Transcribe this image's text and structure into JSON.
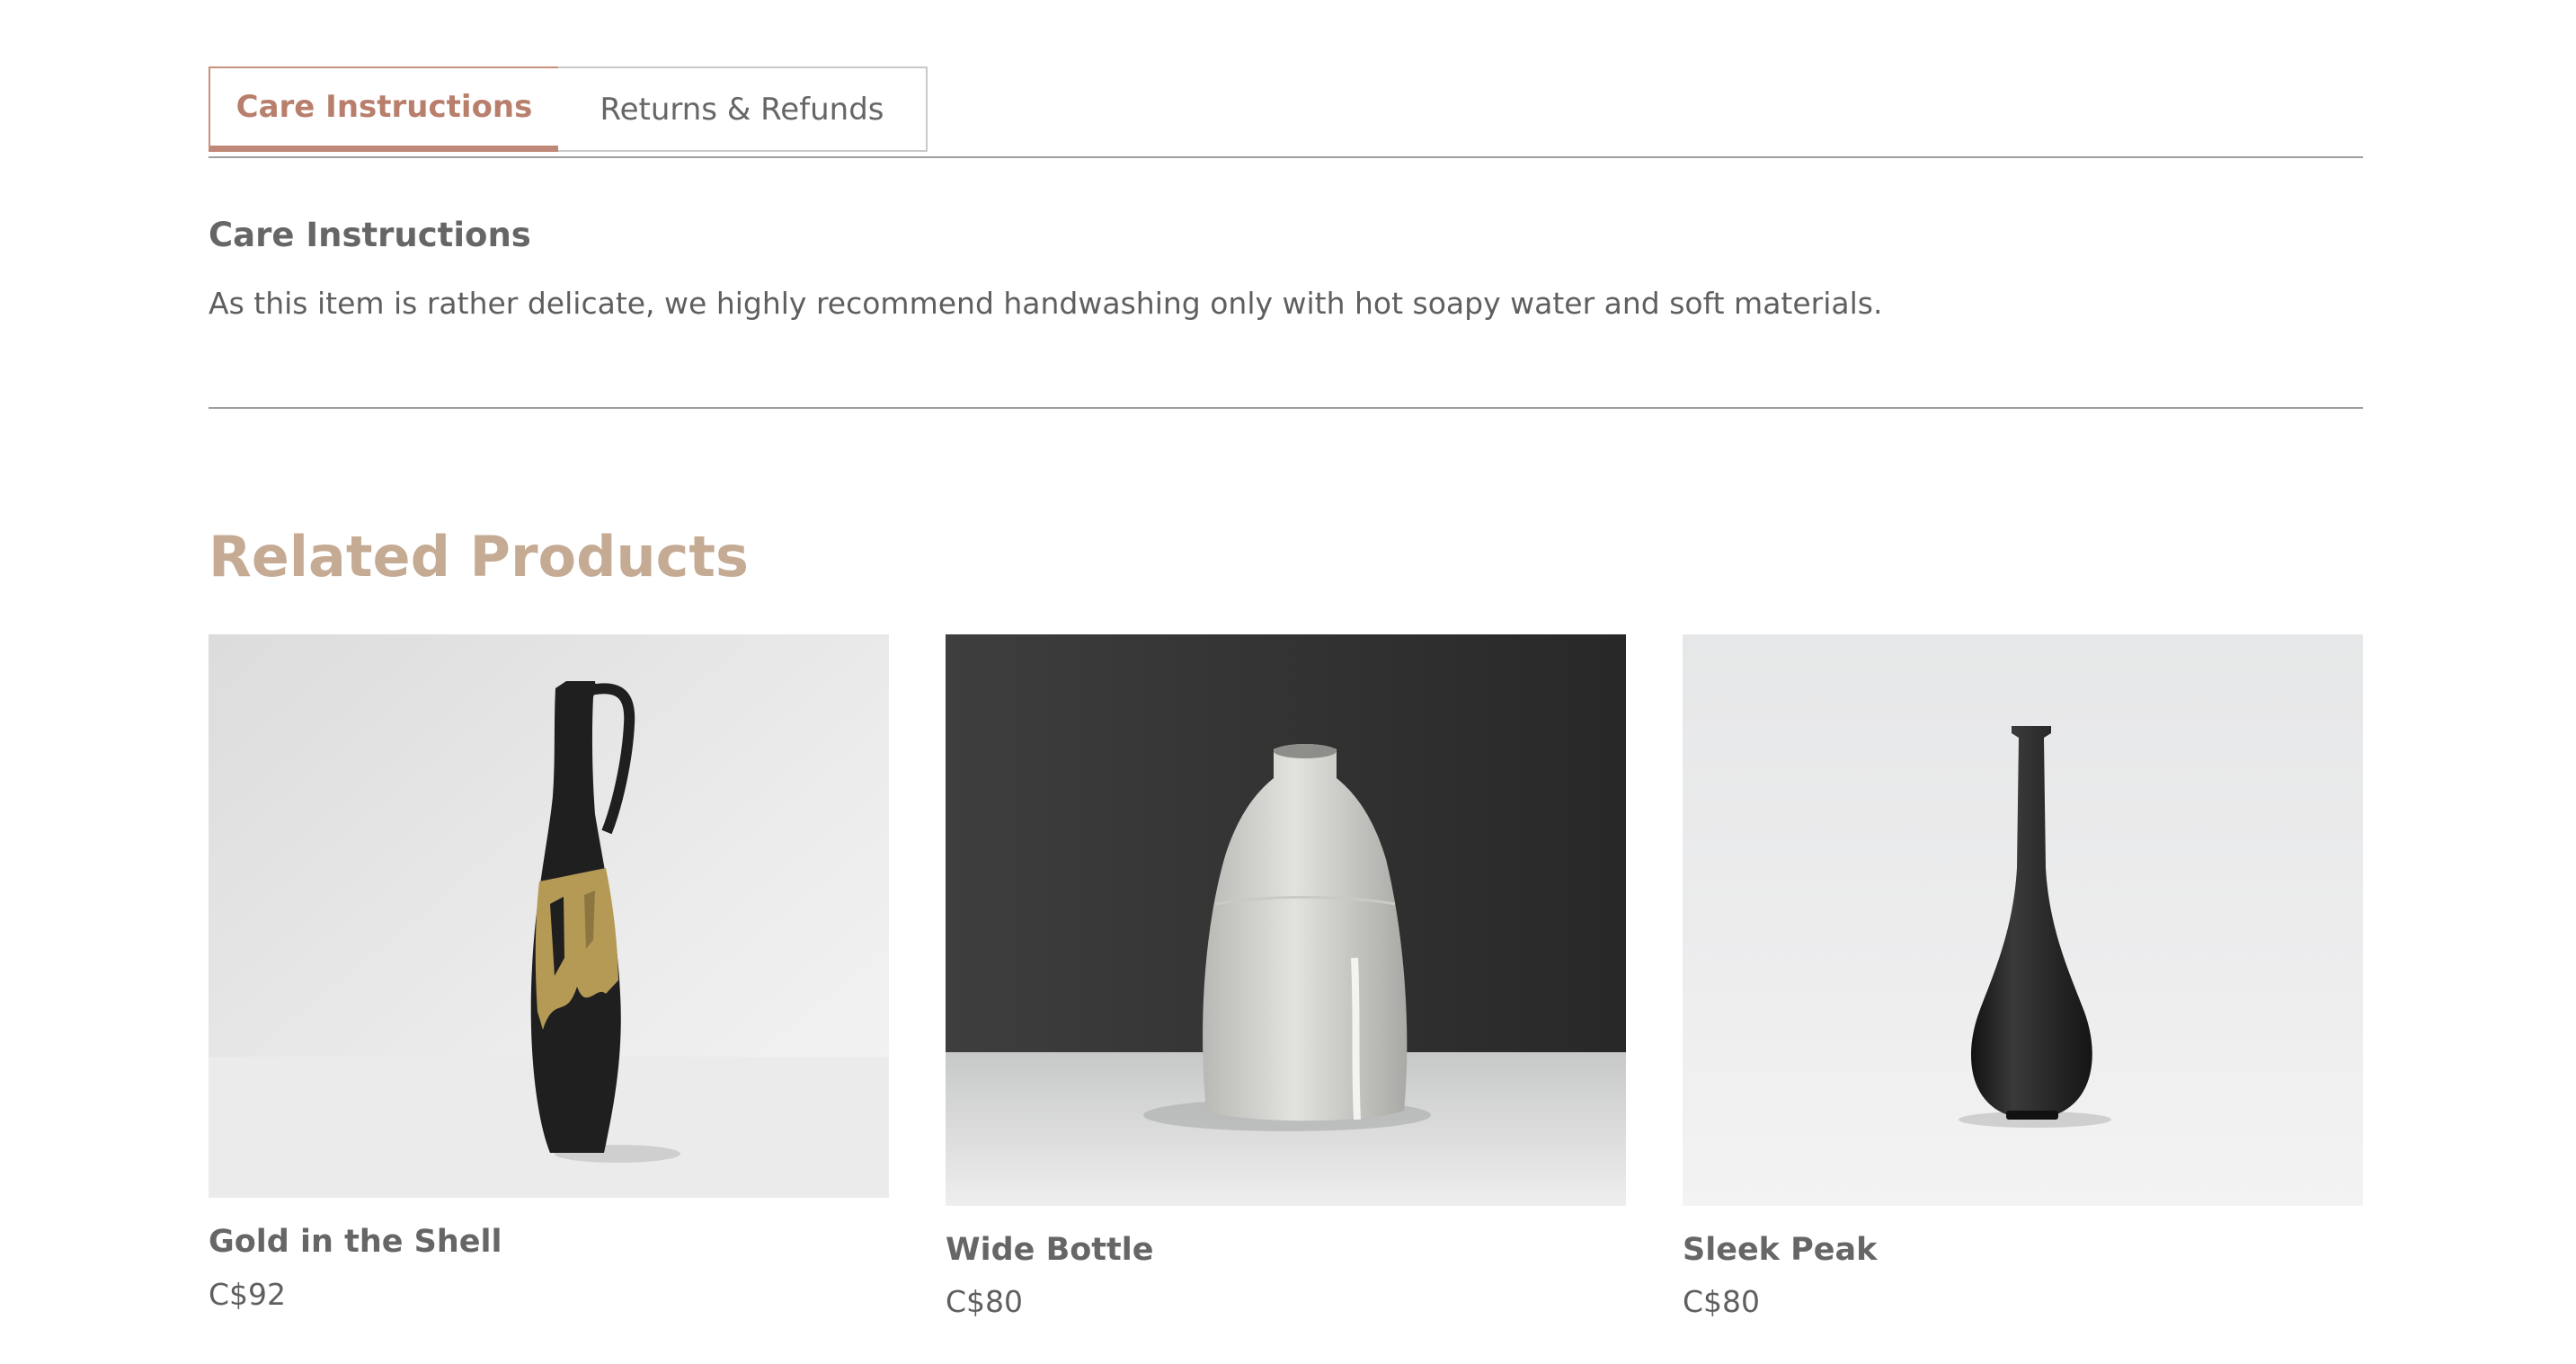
{
  "tabs": [
    {
      "label": "Care Instructions",
      "active": true
    },
    {
      "label": "Returns & Refunds",
      "active": false
    }
  ],
  "care": {
    "title": "Care Instructions",
    "body": "As this item is rather delicate, we highly recommend handwashing only with hot soapy water and soft materials."
  },
  "related": {
    "title": "Related Products",
    "products": [
      {
        "name": "Gold in the Shell",
        "price": "C$92"
      },
      {
        "name": "Wide Bottle",
        "price": "C$80"
      },
      {
        "name": "Sleek Peak",
        "price": "C$80"
      }
    ]
  },
  "colors": {
    "accent": "#bf8877",
    "heading_tan": "#c5ab93",
    "divider": "#9e9e9e",
    "text": "#5f5f5f"
  }
}
